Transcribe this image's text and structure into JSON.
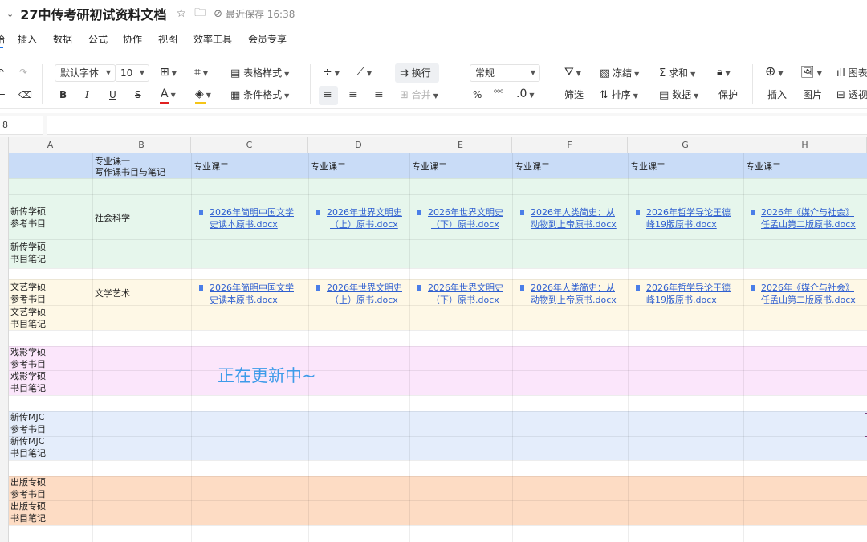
{
  "titlebar": {
    "title": "27中传考研初试资料文档",
    "save_status": "最近保存 16:38"
  },
  "menu": {
    "cut_item": "始",
    "items": [
      "插入",
      "数据",
      "公式",
      "协作",
      "视图",
      "效率工具",
      "会员专享"
    ]
  },
  "toolbar": {
    "font_family": "默认字体",
    "font_size": "10",
    "table_style": "表格样式",
    "conditional_format": "条件格式",
    "wrap": "换行",
    "merge": "合并",
    "number_format": "常规",
    "percent": "%",
    "decimal": ".0",
    "freeze": "冻结",
    "sum": "求和",
    "filter": "筛选",
    "sort": "排序",
    "data": "数据",
    "protect": "保护",
    "insert": "插入",
    "picture": "图片",
    "chart_cut": "图表",
    "pivot_cut": "透视"
  },
  "namebox": "8",
  "columns": [
    "A",
    "B",
    "C",
    "D",
    "E",
    "F",
    "G",
    "H"
  ],
  "header_row": {
    "b1": "专业课一",
    "b2": "写作课书目与笔记",
    "c": "专业课二",
    "d": "专业课二",
    "e": "专业课二",
    "f": "专业课二",
    "g": "专业课二",
    "h": "专业课二"
  },
  "sections": {
    "xinchuan_a1": "新传学硕",
    "xinchuan_a2": "参考书目",
    "xinchuan_b": "社会科学",
    "xinchuan_n1": "新传学硕",
    "xinchuan_n2": "书目笔记",
    "wenyi_a1": "文艺学硕",
    "wenyi_a2": "参考书目",
    "wenyi_b": "文学艺术",
    "wenyi_n1": "文艺学硕",
    "wenyi_n2": "书目笔记",
    "xiying_a1": "戏影学硕",
    "xiying_a2": "参考书目",
    "xiying_n1": "戏影学硕",
    "xiying_n2": "书目笔记",
    "mjc_a1": "新传MJC",
    "mjc_a2": "参考书目",
    "mjc_n1": "新传MJC",
    "mjc_n2": "书目笔记",
    "chuban_a1": "出版专硕",
    "chuban_a2": "参考书目",
    "chuban_n1": "出版专硕",
    "chuban_n2": "书目笔记"
  },
  "files": {
    "c1": "2026年简明中国文学",
    "c2": "史读本原书.docx",
    "d1": "2026年世界文明史",
    "d2": "（上）原书.docx",
    "e1": "2026年世界文明史",
    "e2": "（下）原书.docx",
    "f1": "2026年人类简史：从",
    "f2": "动物到上帝原书.docx",
    "g1": "2026年哲学导论王德",
    "g2": "峰19版原书.docx",
    "h1": "2026年《媒介与社会》",
    "h2": "任孟山第二版原书.docx"
  },
  "updating": "正在更新中~",
  "colors": {
    "header_blue": "#c9dcf7",
    "green": "#e6f6ec",
    "yellow": "#fef8e6",
    "pink": "#fbe6fb",
    "blue": "#e4edfb",
    "orange": "#fddcc4",
    "link": "#2f5fd0",
    "accent_text": "#3d9be9"
  }
}
